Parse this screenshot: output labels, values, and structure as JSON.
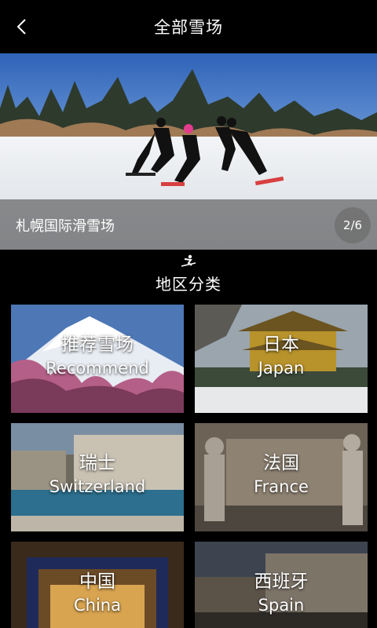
{
  "header": {
    "title": "全部雪场"
  },
  "banner": {
    "title": "札幌国际滑雪场",
    "counter": "2/6"
  },
  "section": {
    "title": "地区分类"
  },
  "regions": [
    {
      "cn": "推荐雪场",
      "en": "Recommend"
    },
    {
      "cn": "日本",
      "en": "Japan"
    },
    {
      "cn": "瑞士",
      "en": "Switzerland"
    },
    {
      "cn": "法国",
      "en": "France"
    },
    {
      "cn": "中国",
      "en": "China"
    },
    {
      "cn": "西班牙",
      "en": "Spain"
    }
  ]
}
